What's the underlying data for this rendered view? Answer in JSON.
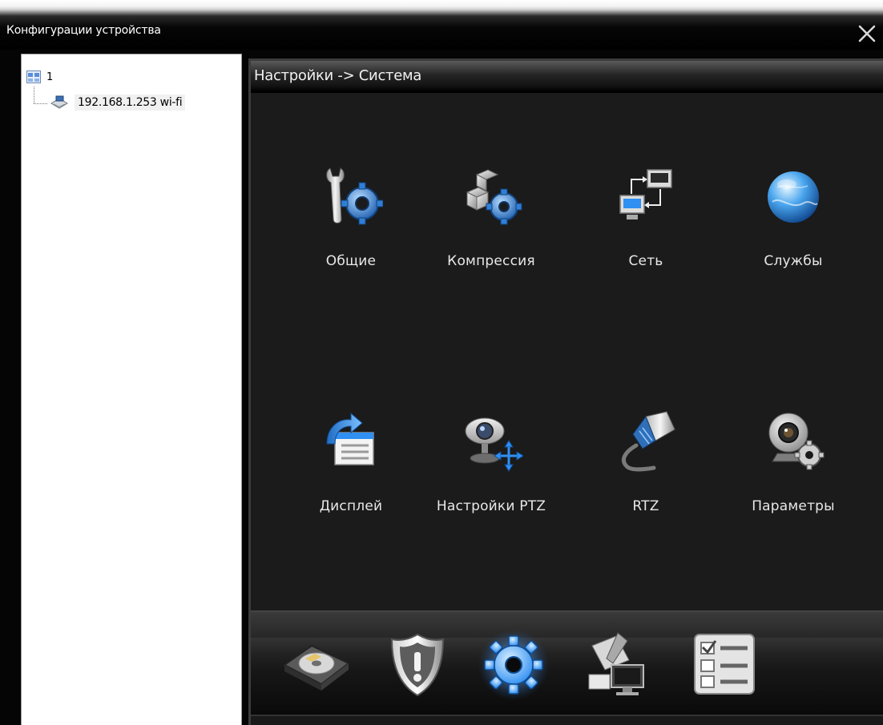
{
  "window": {
    "title": "Конфигурации устройства",
    "close_icon": "close-icon"
  },
  "tree": {
    "root_label": "1",
    "device_label": "192.168.1.253 wi-fi"
  },
  "main": {
    "breadcrumb": "Настройки -> Система",
    "tiles": [
      {
        "label": "Общие",
        "icon": "wrench-gear-icon"
      },
      {
        "label": "Компрессия",
        "icon": "compression-icon"
      },
      {
        "label": "Сеть",
        "icon": "network-icon"
      },
      {
        "label": "Службы",
        "icon": "globe-icon"
      },
      {
        "label": "Дисплей",
        "icon": "display-icon"
      },
      {
        "label": "Настройки PTZ",
        "icon": "ptz-camera-icon"
      },
      {
        "label": "RTZ",
        "icon": "cable-icon"
      },
      {
        "label": "Параметры",
        "icon": "webcam-gear-icon"
      }
    ],
    "dock": [
      {
        "icon": "storage-disk-icon"
      },
      {
        "icon": "alarm-shield-icon"
      },
      {
        "icon": "system-gear-icon",
        "active": true
      },
      {
        "icon": "tools-monitor-icon"
      },
      {
        "icon": "checklist-icon"
      }
    ]
  },
  "colors": {
    "accent_blue": "#2f8ff2",
    "panel_bg": "#1b1b1b",
    "text_light": "#e8e8e8"
  }
}
